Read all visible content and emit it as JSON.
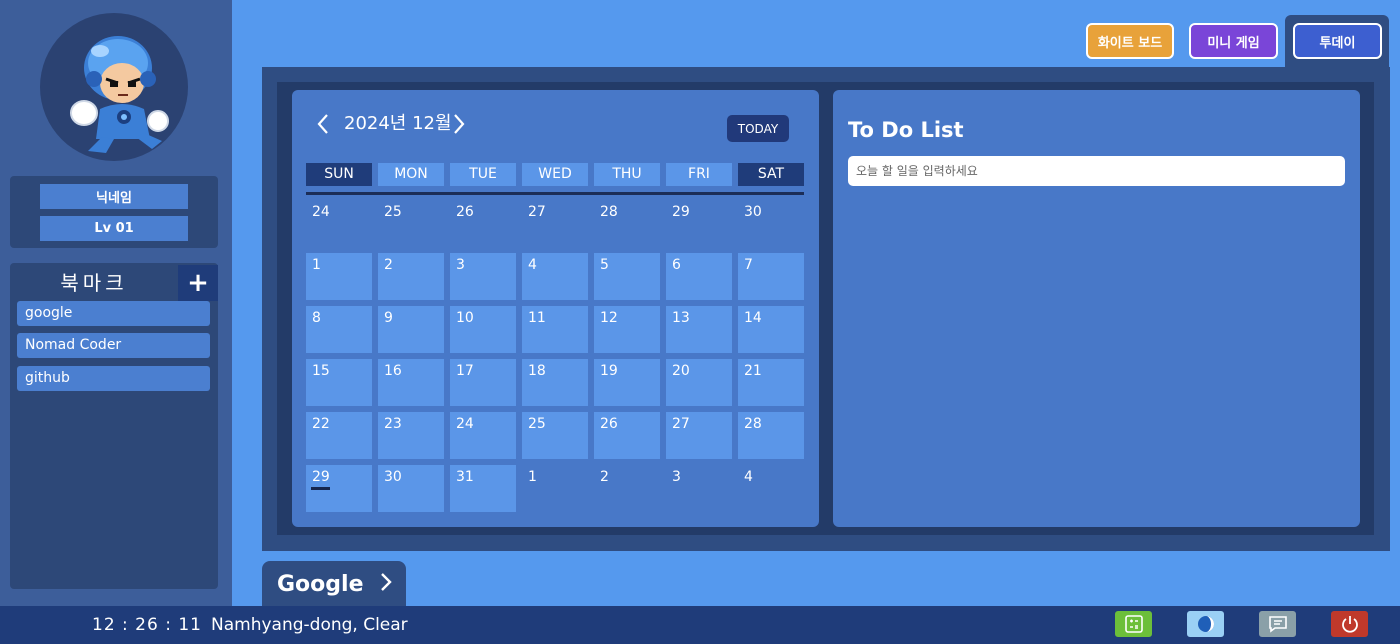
{
  "profile": {
    "nickname": "닉네임",
    "level": "Lv 01"
  },
  "bookmarks": {
    "title": "북마크",
    "add_label": "+",
    "items": [
      {
        "label": "google"
      },
      {
        "label": "Nomad Coder"
      },
      {
        "label": "github"
      }
    ]
  },
  "top_buttons": {
    "whiteboard": "화이트 보드",
    "minigame": "미니 게임",
    "today": "투데이"
  },
  "calendar": {
    "month_label": "2024년 12월",
    "prev_icon": "‹",
    "next_icon": "›",
    "today_button": "TODAY",
    "weekdays": [
      "SUN",
      "MON",
      "TUE",
      "WED",
      "THU",
      "FRI",
      "SAT"
    ],
    "weeks": [
      [
        "24",
        "25",
        "26",
        "27",
        "28",
        "29",
        "30"
      ],
      [
        "1",
        "2",
        "3",
        "4",
        "5",
        "6",
        "7"
      ],
      [
        "8",
        "9",
        "10",
        "11",
        "12",
        "13",
        "14"
      ],
      [
        "15",
        "16",
        "17",
        "18",
        "19",
        "20",
        "21"
      ],
      [
        "22",
        "23",
        "24",
        "25",
        "26",
        "27",
        "28"
      ],
      [
        "29",
        "30",
        "31",
        "1",
        "2",
        "3",
        "4"
      ]
    ],
    "selected_day": "29"
  },
  "todo": {
    "title": "To Do List",
    "input_placeholder": "오늘 할 일을 입력하세요",
    "input_value": ""
  },
  "search_engine": {
    "label": "Google",
    "icon": "chevron-right-icon"
  },
  "taskbar": {
    "clock": "12 : 26 : 11",
    "weather": "Namhyang-dong, Clear",
    "icons": [
      "calculator-icon",
      "theme-toggle-icon",
      "chat-icon",
      "power-icon"
    ]
  },
  "colors": {
    "background": "#5599ee",
    "panel": "#4878c8",
    "frame": "#2f4d82",
    "taskbar": "#1f3c7a",
    "whiteboard_button": "#e8a23a",
    "minigame_button": "#7a45d8",
    "today_button": "#3d5fd0",
    "calculator": "#6cbf3a",
    "theme": "#9ad0f5",
    "chat": "#8aa0a8",
    "power": "#c0392b"
  }
}
